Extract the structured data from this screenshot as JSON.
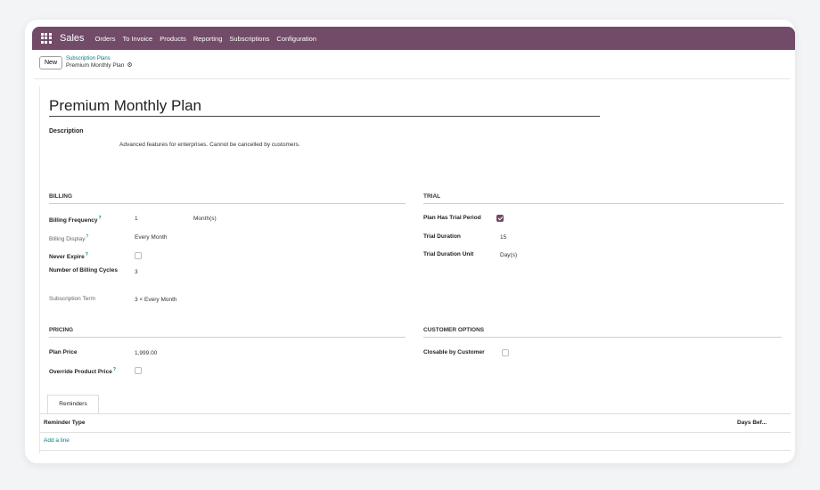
{
  "navbar": {
    "brand": "Sales",
    "menu": [
      "Orders",
      "To Invoice",
      "Products",
      "Reporting",
      "Subscriptions",
      "Configuration"
    ]
  },
  "control_panel": {
    "new_label": "New",
    "breadcrumb_parent": "Subscription Plans",
    "breadcrumb_current": "Premium Monthly Plan"
  },
  "record": {
    "title": "Premium Monthly Plan",
    "description_label": "Description",
    "description": "Advanced features for enterprises. Cannot be cancelled by customers."
  },
  "billing": {
    "heading": "BILLING",
    "frequency_label": "Billing Frequency",
    "frequency_value": "1",
    "frequency_unit": "Month(s)",
    "display_label": "Billing Display",
    "display_value": "Every Month",
    "never_expire_label": "Never Expire",
    "never_expire": false,
    "cycles_label": "Number of Billing Cycles",
    "cycles_value": "3",
    "term_label": "Subscription Term",
    "term_value": "3 × Every Month"
  },
  "trial": {
    "heading": "TRIAL",
    "has_trial_label": "Plan Has Trial Period",
    "has_trial": true,
    "duration_label": "Trial Duration",
    "duration_value": "15",
    "unit_label": "Trial Duration Unit",
    "unit_value": "Day(s)"
  },
  "pricing": {
    "heading": "PRICING",
    "price_label": "Plan Price",
    "price_value": "1,999.00",
    "override_label": "Override Product Price",
    "override": false
  },
  "customer_options": {
    "heading": "CUSTOMER OPTIONS",
    "closable_label": "Closable by Customer",
    "closable": false
  },
  "reminders": {
    "tab_label": "Reminders",
    "col_type": "Reminder Type",
    "col_days": "Days Bef...",
    "add_line": "Add a line"
  },
  "tooltip_mark": "?",
  "colors": {
    "brand": "#714b67",
    "link": "#017e84"
  }
}
